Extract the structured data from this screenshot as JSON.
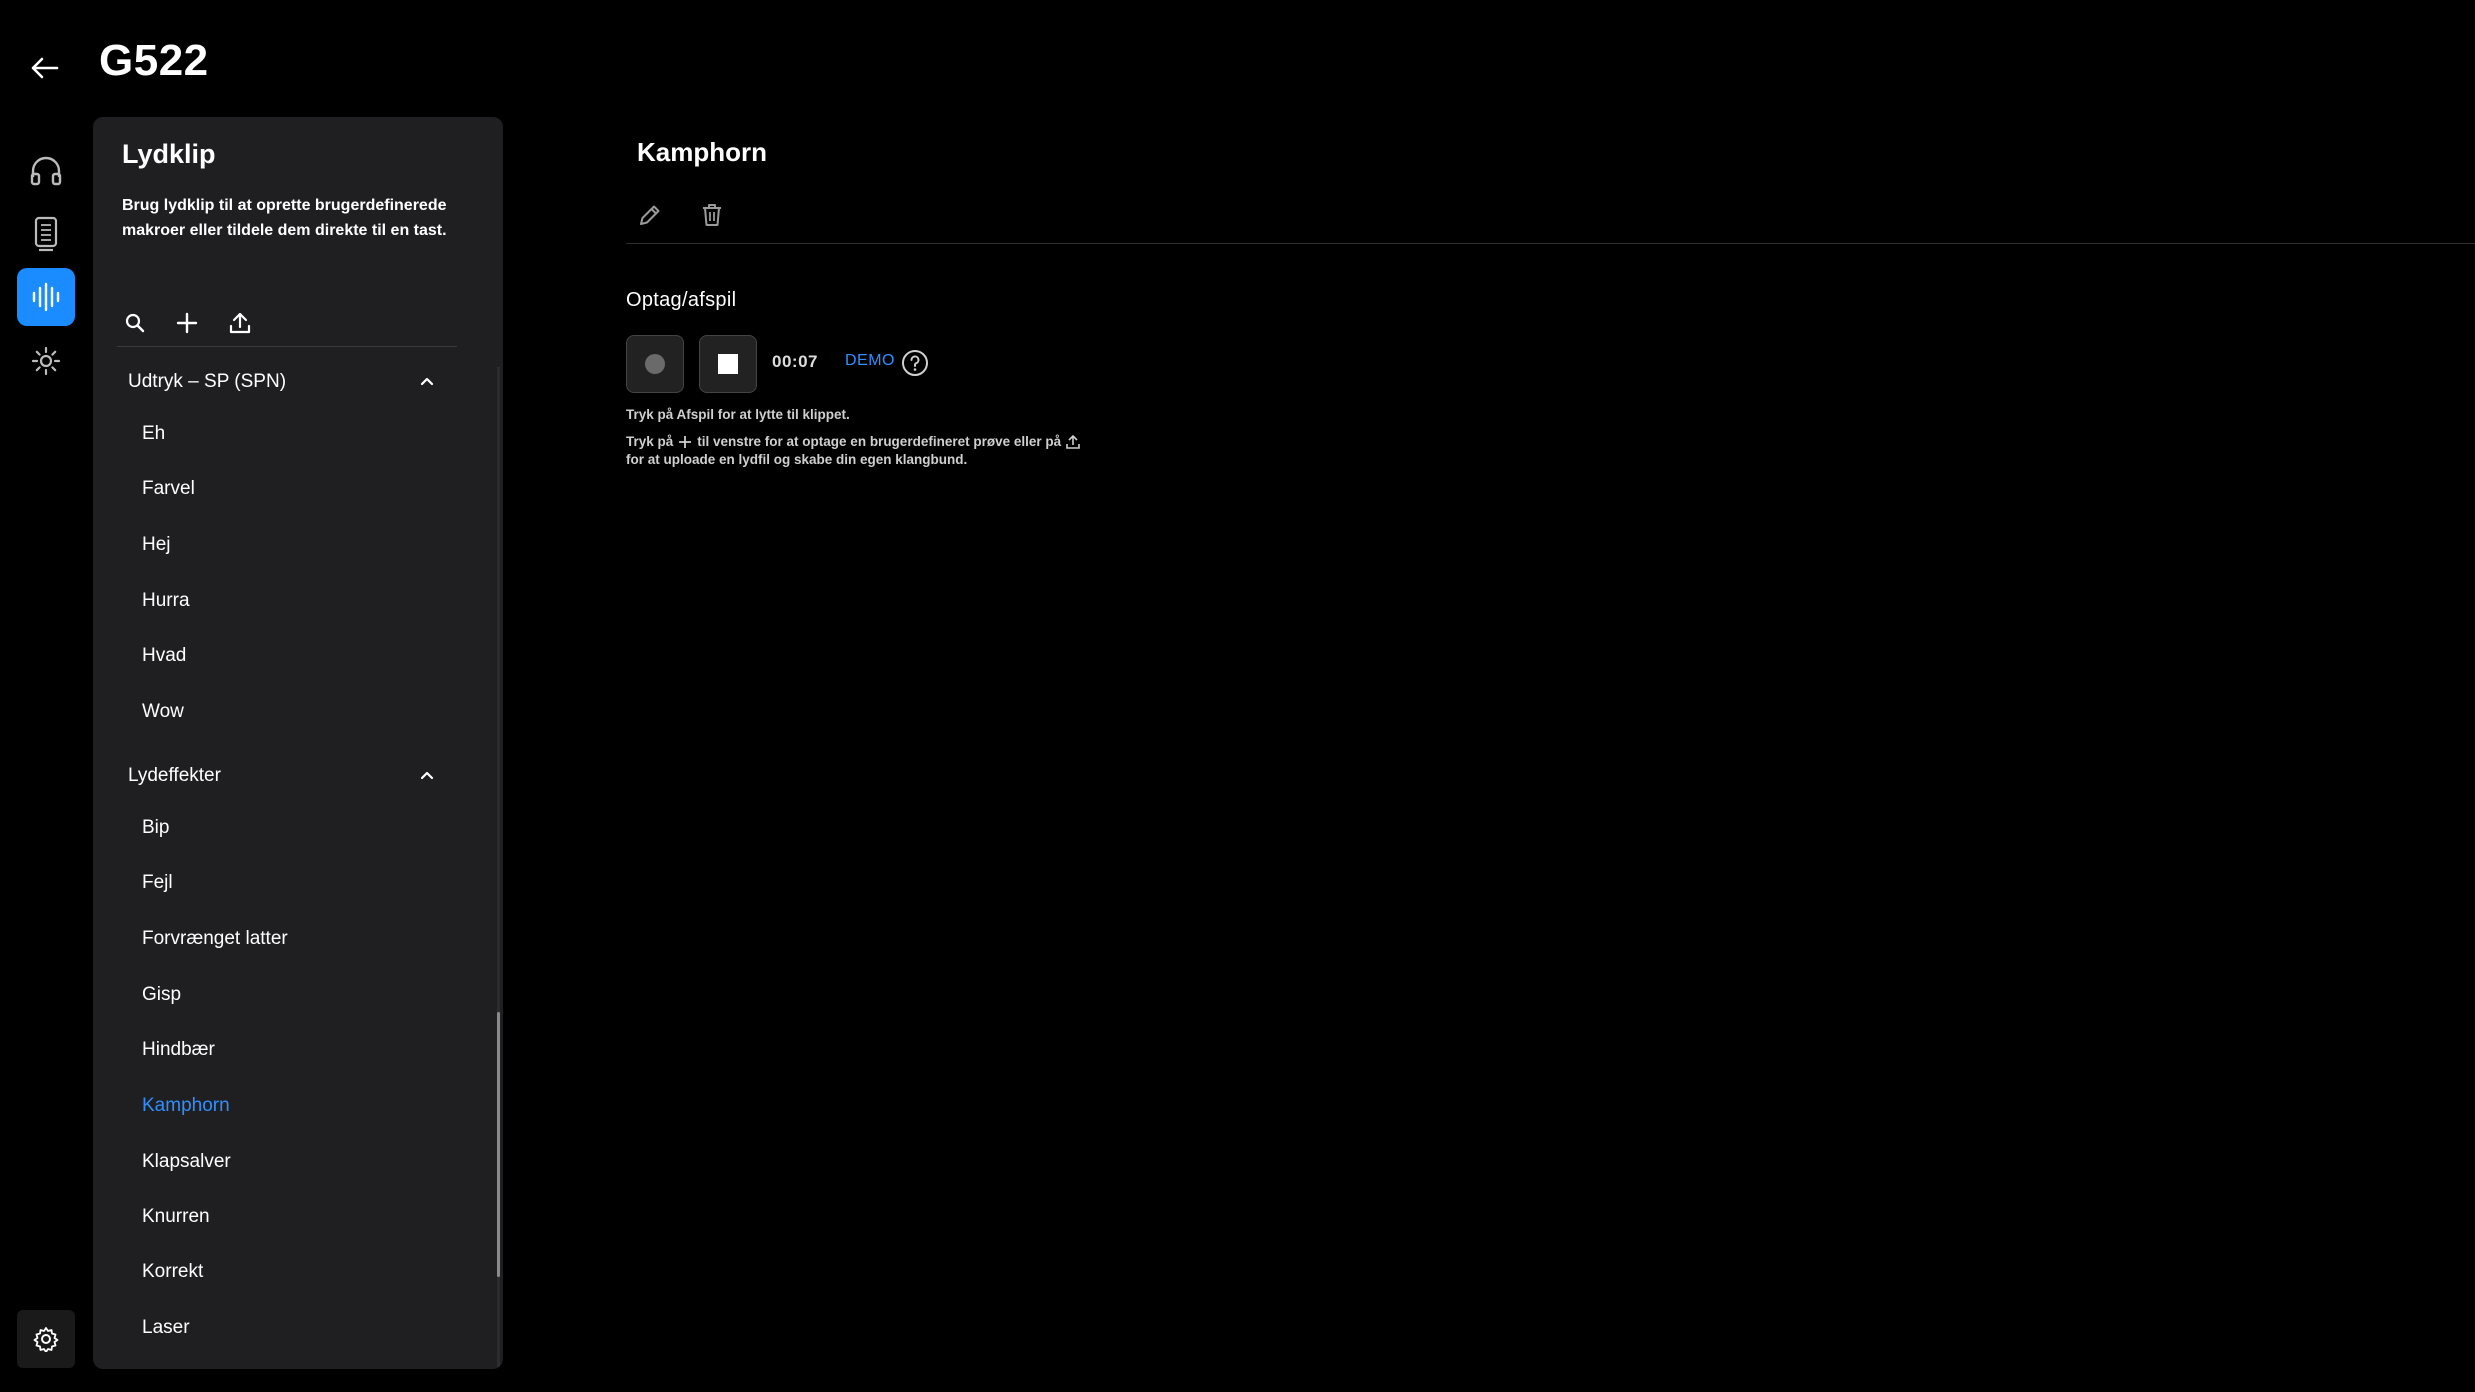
{
  "header": {
    "title": "G522"
  },
  "rail": {
    "items": [
      {
        "name": "headset-icon",
        "active": false
      },
      {
        "name": "device-remote-icon",
        "active": false
      },
      {
        "name": "sound-wave-icon",
        "active": true
      },
      {
        "name": "brightness-icon",
        "active": false
      }
    ],
    "settings_icon": "gear-icon"
  },
  "panel": {
    "title": "Lydklip",
    "description": "Brug lydklip til at oprette brugerdefinerede makroer eller tildele dem direkte til en tast.",
    "groups": [
      {
        "label": "Udtryk – SP (SPN)",
        "expanded": true,
        "items": [
          "Eh",
          "Farvel",
          "Hej",
          "Hurra",
          "Hvad",
          "Wow"
        ]
      },
      {
        "label": "Lydeffekter",
        "expanded": true,
        "items": [
          "Bip",
          "Fejl",
          "Forvrænget latter",
          "Gisp",
          "Hindbær",
          "Kamphorn",
          "Klapsalver",
          "Knurren",
          "Korrekt",
          "Laser"
        ]
      }
    ],
    "selected_item": "Kamphorn"
  },
  "main": {
    "clip_title": "Kamphorn",
    "section_label": "Optag/afspil",
    "time": "00:07",
    "demo_label": "DEMO",
    "hint_1": "Tryk på Afspil for at lytte til klippet.",
    "hint_2a": "Tryk på",
    "hint_2b": "til venstre for at optage en brugerdefineret prøve eller på",
    "hint_3": "for at uploade en lydfil og skabe din egen klangbund."
  },
  "colors": {
    "accent": "#1a8cff",
    "selected_text": "#2f8fff",
    "panel_bg": "#1f1f22",
    "background": "#000000"
  }
}
